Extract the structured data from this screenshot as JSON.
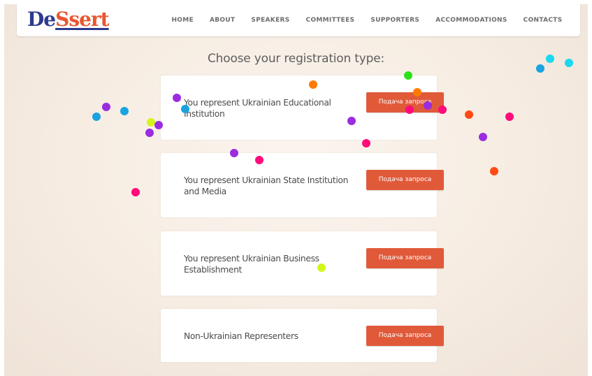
{
  "brand": {
    "logo_part_1": "De",
    "logo_part_2": "Ssert"
  },
  "nav": {
    "items": [
      "HOME",
      "ABOUT",
      "SPEAKERS",
      "COMMITTEES",
      "SUPPORTERS",
      "ACCOMMODATIONS",
      "CONTACTS"
    ]
  },
  "main": {
    "title": "Choose your registration type:",
    "cards": [
      {
        "label": "You represent Ukrainian Educational Institution",
        "button": "Подача запроса"
      },
      {
        "label": "You represent Ukrainian State Institution and Media",
        "button": "Подача запроса"
      },
      {
        "label": "You represent Ukrainian Business Establishment",
        "button": "Подача запроса"
      },
      {
        "label": "Non-Ukrainian Representers",
        "button": "Подача запроса"
      }
    ]
  },
  "colors": {
    "accent": "#e05a3a",
    "logo_blue": "#2d3a8c",
    "logo_orange": "#e8562f",
    "confetti": [
      "#1aa3e0",
      "#9b2ce0",
      "#ff0b7a",
      "#ff7a00",
      "#d4f51c",
      "#2ee01a",
      "#1ad8f0",
      "#ff4a14"
    ]
  },
  "decor": {
    "icon": "confetti-dots"
  }
}
